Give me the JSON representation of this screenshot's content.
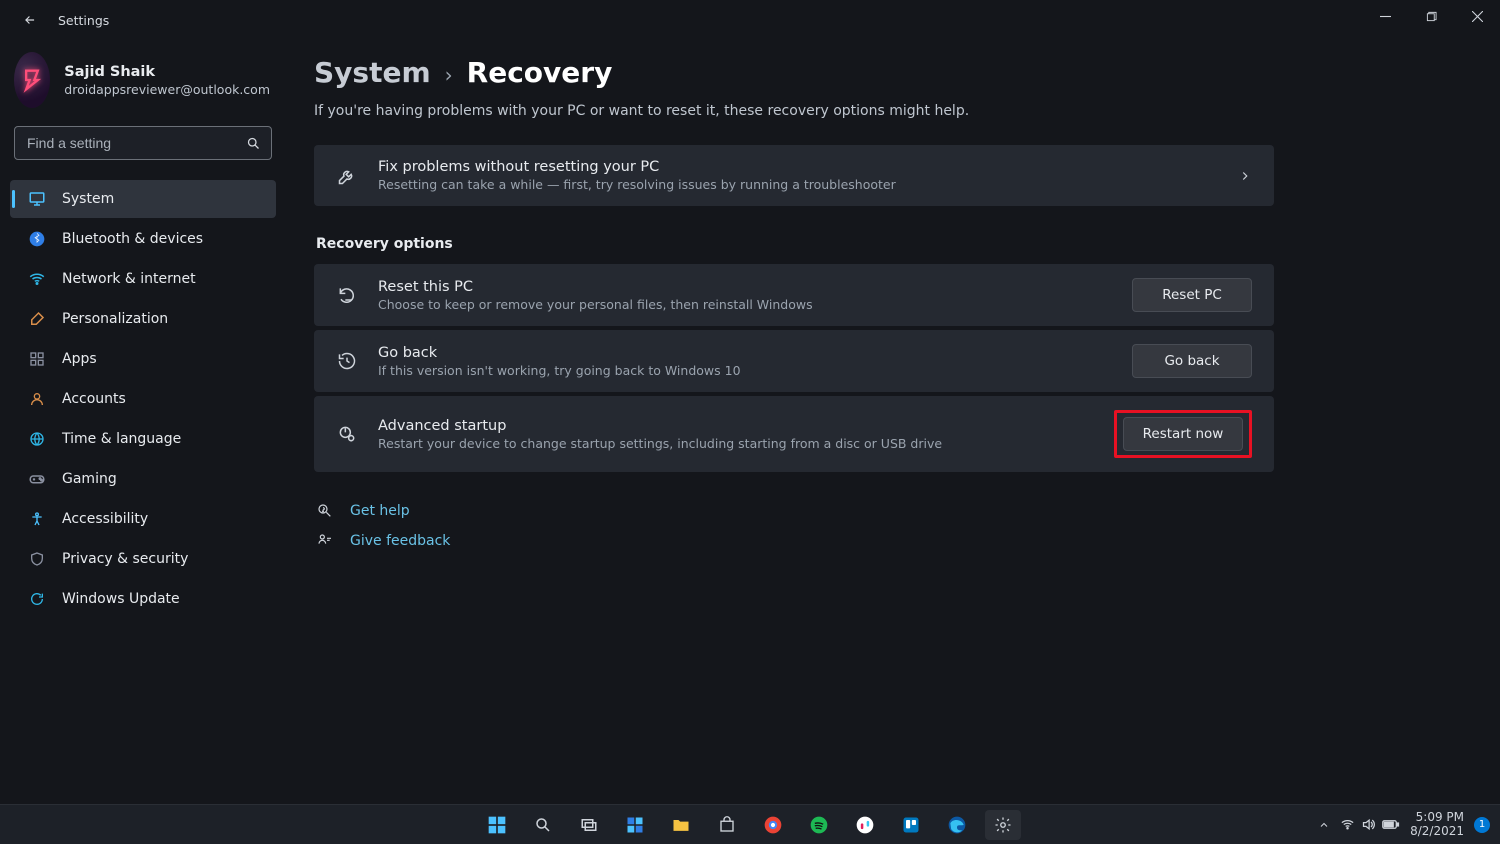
{
  "window": {
    "title": "Settings"
  },
  "profile": {
    "name": "Sajid Shaik",
    "email": "droidappsreviewer@outlook.com"
  },
  "search": {
    "placeholder": "Find a setting"
  },
  "sidebar": {
    "items": [
      {
        "id": "system",
        "label": "System",
        "icon": "display",
        "color": "#4cc2ff"
      },
      {
        "id": "bluetooth",
        "label": "Bluetooth & devices",
        "icon": "bluetooth",
        "color": "#2f7ee6"
      },
      {
        "id": "network",
        "label": "Network & internet",
        "icon": "wifi",
        "color": "#2fb6e6"
      },
      {
        "id": "personalization",
        "label": "Personalization",
        "icon": "brush",
        "color": "#d98e4a"
      },
      {
        "id": "apps",
        "label": "Apps",
        "icon": "apps",
        "color": "#8a90a0"
      },
      {
        "id": "accounts",
        "label": "Accounts",
        "icon": "person",
        "color": "#d98e4a"
      },
      {
        "id": "time",
        "label": "Time & language",
        "icon": "globe",
        "color": "#2fb6e6"
      },
      {
        "id": "gaming",
        "label": "Gaming",
        "icon": "gamepad",
        "color": "#8a90a0"
      },
      {
        "id": "accessibility",
        "label": "Accessibility",
        "icon": "accessibility",
        "color": "#4cc2ff"
      },
      {
        "id": "privacy",
        "label": "Privacy & security",
        "icon": "shield",
        "color": "#8a90a0"
      },
      {
        "id": "update",
        "label": "Windows Update",
        "icon": "update",
        "color": "#2fb6e6"
      }
    ],
    "selected": "system"
  },
  "page": {
    "breadcrumb_parent": "System",
    "breadcrumb_current": "Recovery",
    "subtitle": "If you're having problems with your PC or want to reset it, these recovery options might help.",
    "fix_card": {
      "title": "Fix problems without resetting your PC",
      "desc": "Resetting can take a while — first, try resolving issues by running a troubleshooter"
    },
    "section_title": "Recovery options",
    "rows": [
      {
        "id": "reset",
        "title": "Reset this PC",
        "desc": "Choose to keep or remove your personal files, then reinstall Windows",
        "button": "Reset PC"
      },
      {
        "id": "goback",
        "title": "Go back",
        "desc": "If this version isn't working, try going back to Windows 10",
        "button": "Go back"
      },
      {
        "id": "advanced",
        "title": "Advanced startup",
        "desc": "Restart your device to change startup settings, including starting from a disc or USB drive",
        "button": "Restart now"
      }
    ],
    "help_link": "Get help",
    "feedback_link": "Give feedback"
  },
  "taskbar": {
    "time": "5:09 PM",
    "date": "8/2/2021",
    "notifications": "1"
  }
}
